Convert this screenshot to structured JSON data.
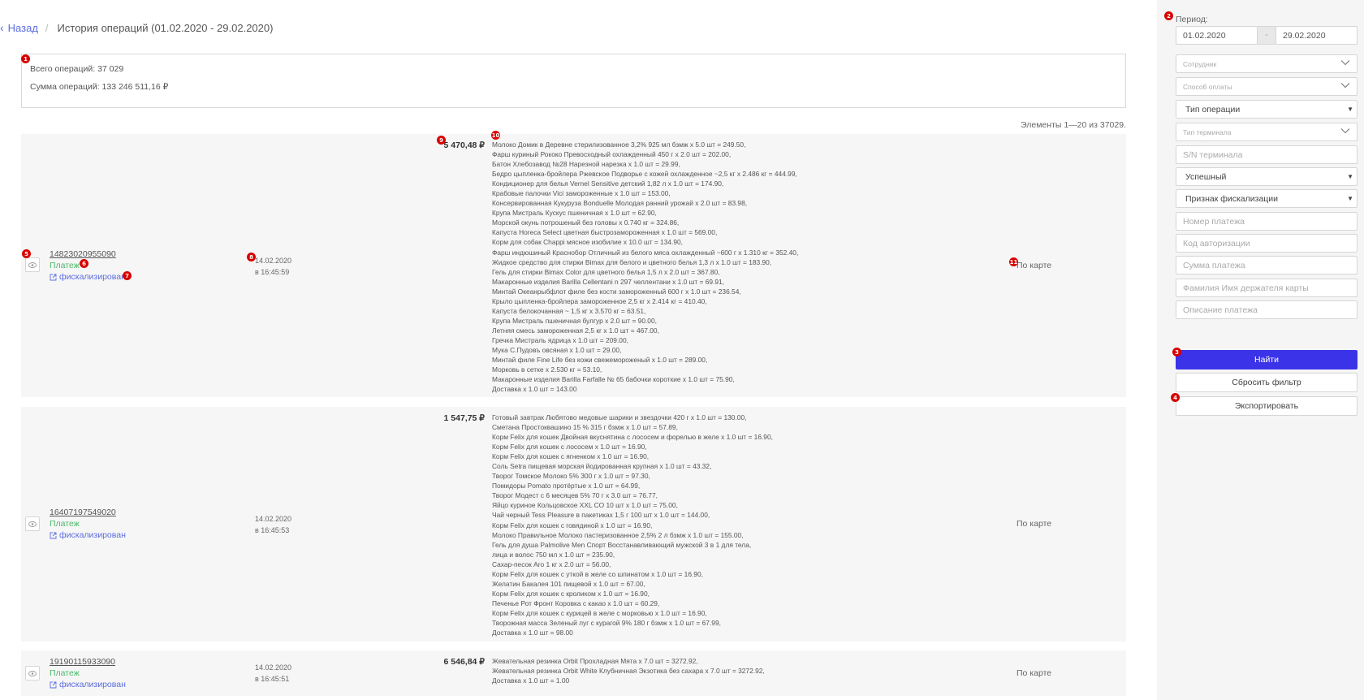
{
  "breadcrumb": {
    "back_label": "Назад",
    "separator": "/",
    "title": "История операций (01.02.2020 - 29.02.2020)"
  },
  "summary": {
    "total_ops": "Всего операций: 37 029",
    "total_sum": "Сумма операций: 133 246 511,16 ₽"
  },
  "pagination": {
    "label": "Элементы 1—20 из 37029."
  },
  "badges": [
    "1",
    "2",
    "3",
    "4",
    "5",
    "6",
    "7",
    "8",
    "9",
    "10",
    "11"
  ],
  "operations": [
    {
      "id": "14823020955090",
      "type": "Платеж",
      "fiscal": "фискализирован",
      "date": "14.02.2020",
      "time": "в 16:45:59",
      "amount": "5 470,48 ₽",
      "method": "По карте",
      "items": [
        "Молоко Домик в Деревне стерилизованное 3,2% 925 мл бзмж x 5.0 шт = 249.50,",
        "Фарш куриный Рококо Превосходный охлажденный 450 г x 2.0 шт = 202.00,",
        "Батон Хлебозавод №28 Нарезной нарезка x 1.0 шт = 29.99,",
        "Бедро цыпленка-бройлера Ржевское Подворье с кожей охлажденное ~2,5 кг x 2.486 кг = 444.99,",
        "Кондиционер для белья Vernel Sensitive детский 1,82 л x 1.0 шт = 174.90,",
        "Крабовые палочки Vici замороженные x 1.0 шт = 153.00,",
        "Консервированная Кукуруза Bonduelle Молодая ранний урожай x 2.0 шт = 83.98,",
        "Крупа Мистраль Кускус пшеничная x 1.0 шт = 62.90,",
        "Морской окунь потрошеный без головы x 0.740 кг = 324.86,",
        "Капуста Horeca Select цветная быстрозамороженная x 1.0 шт = 569.00,",
        "Корм для собак Chappi мясное изобилие x 10.0 шт = 134.90,",
        "Фарш индюшиный Краснобор Отличный из белого мяса охлажденный ~600 г x 1.310 кг = 352.40,",
        "Жидкое средство для стирки Bimax для белого и цветного белья 1,3 л x 1.0 шт = 183.90,",
        "Гель для стирки Bimax Color для цветного белья 1,5 л x 2.0 шт = 367.80,",
        "Макаронные изделия Barilla Cellentani n 297 челлентани x 1.0 шт = 69.91,",
        "Минтай Океанрыбфлот филе без кости замороженный 600 г x 1.0 шт = 236.54,",
        "Крыло цыпленка-бройлера замороженное 2,5 кг x 2.414 кг = 410.40,",
        "Капуста белокочанная ~ 1,5 кг x 3.570 кг = 63.51,",
        "Крупа Мистраль пшеничная булгур x 2.0 шт = 90.00,",
        "Летняя смесь замороженная 2,5 кг x 1.0 шт = 467.00,",
        "Гречка Мистраль ядрица x 1.0 шт = 209.00,",
        "Мука С.Пудовъ овсяная x 1.0 шт = 29.00,",
        "Минтай филе Fine Life без кожи свежемороженый x 1.0 шт = 289.00,",
        "Морковь в сетке x 2.530 кг = 53.10,",
        "Макаронные изделия Barilla Farfalle № 65 бабочки короткие x 1.0 шт = 75.90,",
        "Доставка x 1.0 шт = 143.00"
      ]
    },
    {
      "id": "16407197549020",
      "type": "Платеж",
      "fiscal": "фискализирован",
      "date": "14.02.2020",
      "time": "в 16:45:53",
      "amount": "1 547,75 ₽",
      "method": "По карте",
      "items": [
        "Готовый завтрак Любятово медовые шарики и звездочки 420 г x 1.0 шт = 130.00,",
        "Сметана Простоквашино 15 % 315 г бзмж x 1.0 шт = 57.89,",
        "Корм Felix для кошек Двойная вкуснятина с лососем и форелью в желе x 1.0 шт = 16.90,",
        "Корм Felix для кошек с лососем x 1.0 шт = 16.90,",
        "Корм Felix для кошек с ягненком x 1.0 шт = 16.90,",
        "Соль Setra пищевая морская йодированная крупная x 1.0 шт = 43.32,",
        "Творог Томское Молоко 5% 300 г x 1.0 шт = 97.30,",
        "Помидоры Pomato протёртые x 1.0 шт = 64.99,",
        "Творог Модест с 6 месяцев 5% 70 г x 3.0 шт = 76.77,",
        "Яйцо куриное Кольцовское XXL CO 10 шт x 1.0 шт = 75.00,",
        "Чай черный Tess Pleasure в пакетиках 1,5 г 100 шт x 1.0 шт = 144.00,",
        "Корм Felix для кошек с говядиной x 1.0 шт = 16.90,",
        "Молоко Правильное Молоко пастеризованное 2,5% 2 л бзмж x 1.0 шт = 155.00,",
        "Гель для душа Palmolive Men Спорт Восстанавливающий мужской 3 в 1 для тела,",
        "лица и волос 750 мл x 1.0 шт = 235.90,",
        "Сахар-песок Aro 1 кг x 2.0 шт = 56.00,",
        "Корм Felix для кошек с уткой в желе со шпинатом x 1.0 шт = 16.90,",
        "Желатин Бакалея 101 пищевой x 1.0 шт = 67.00,",
        "Корм Felix для кошек с кроликом x 1.0 шт = 16.90,",
        "Печенье Рот Фронт Коровка с какао x 1.0 шт = 60.29,",
        "Корм Felix для кошек с курицей в желе с морковью x 1.0 шт = 16.90,",
        "Творожная масса Зеленый луг с курагой 9% 180 г бзмж x 1.0 шт = 67.99,",
        "Доставка x 1.0 шт = 98.00"
      ]
    },
    {
      "id": "19190115933090",
      "type": "Платеж",
      "fiscal": "фискализирован",
      "date": "14.02.2020",
      "time": "в 16:45:51",
      "amount": "6 546,84 ₽",
      "method": "По карте",
      "items": [
        "Жевательная резинка Orbit Прохладная Мята x 7.0 шт = 3272.92,",
        "Жевательная резинка Orbit White Клубничная Экзотика без сахара x 7.0 шт = 3272.92,",
        "Доставка x 1.0 шт = 1.00"
      ]
    }
  ],
  "filters": {
    "period_label": "Период:",
    "date_from": "01.02.2020",
    "date_sep": "-",
    "date_to": "29.02.2020",
    "employee": "Сотрудник",
    "payment_method": "Способ оплаты",
    "operation_type": "Тип операции",
    "terminal_type": "Тип терминала",
    "terminal_sn": "S/N терминала",
    "status": "Успешный",
    "fiscal_sign": "Признак фискализации",
    "payment_number": "Номер платежа",
    "auth_code": "Код авторизации",
    "payment_sum": "Сумма платежа",
    "card_holder": "Фамилия Имя держателя карты",
    "payment_description": "Описание платежа"
  },
  "actions": {
    "find": "Найти",
    "reset": "Сбросить фильтр",
    "export": "Экспортировать"
  },
  "colors": {
    "primary": "#3b33e8",
    "link": "#5b6de0",
    "success": "#4cb86a",
    "badge": "#d80000"
  }
}
